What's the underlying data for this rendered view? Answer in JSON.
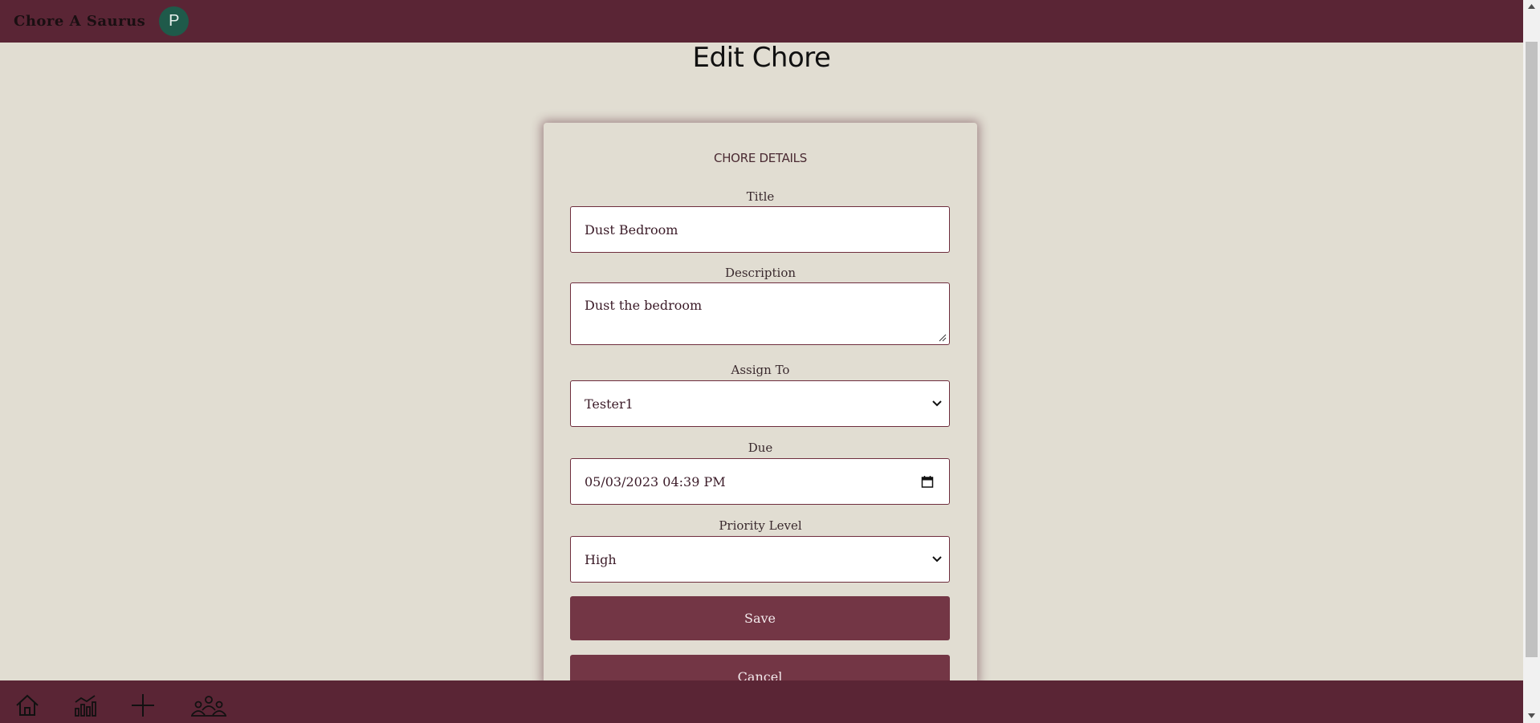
{
  "app": {
    "brand": "Chore A Saurus",
    "avatar_initial": "P"
  },
  "page": {
    "title": "Edit Chore"
  },
  "form": {
    "heading": "CHORE DETAILS",
    "title": {
      "label": "Title",
      "value": "Dust Bedroom"
    },
    "description": {
      "label": "Description",
      "value": "Dust the bedroom"
    },
    "assign_to": {
      "label": "Assign To",
      "selected": "Tester1"
    },
    "due": {
      "label": "Due",
      "value": "05/03/2023 04:39 PM"
    },
    "priority": {
      "label": "Priority Level",
      "selected": "High"
    },
    "save_label": "Save",
    "cancel_label": "Cancel"
  },
  "bottom_nav": {
    "items": [
      {
        "icon": "home-icon"
      },
      {
        "icon": "stats-icon"
      },
      {
        "icon": "add-icon"
      },
      {
        "icon": "group-icon"
      }
    ]
  },
  "colors": {
    "bar": "#5a2535",
    "background": "#e1ddd2",
    "button": "#733645",
    "avatar": "#1f5a4a"
  }
}
